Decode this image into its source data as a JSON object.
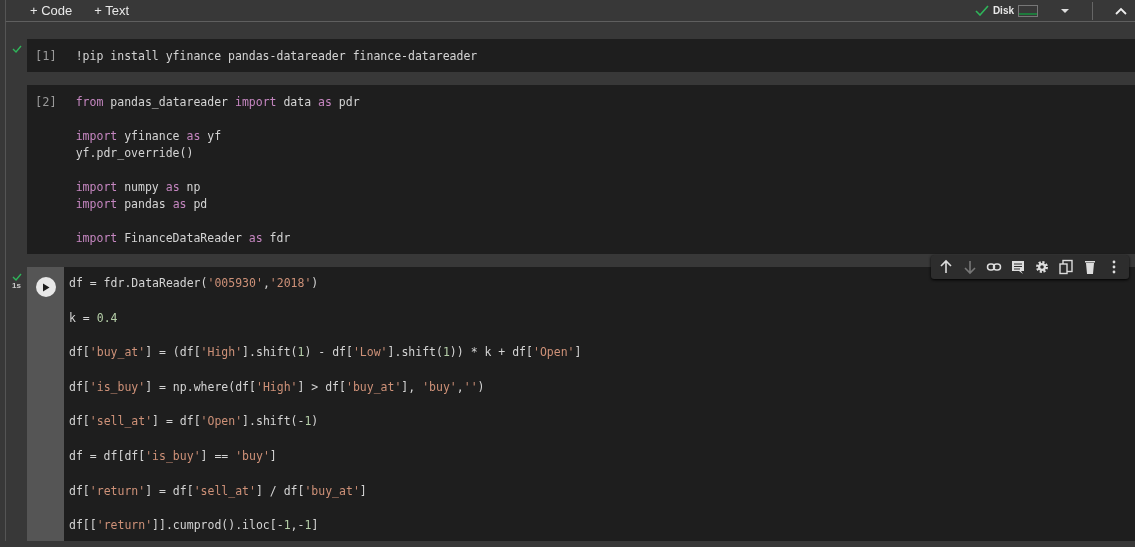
{
  "toolbar": {
    "add_buttons": [
      {
        "icon": "+",
        "label": "Code"
      },
      {
        "icon": "+",
        "label": "Text"
      }
    ],
    "resources": {
      "connected": true,
      "disk_label": "Disk"
    }
  },
  "cells": [
    {
      "execution": "[1]",
      "executed": true,
      "selected": false,
      "lines": [
        {
          "gap_before": false,
          "tokens": [
            {
              "kind": "plain",
              "text": "!pip install yfinance pandas-datareader finance-datareader"
            }
          ]
        }
      ]
    },
    {
      "execution": "[2]",
      "executed": false,
      "selected": false,
      "lines": [
        {
          "gap_before": false,
          "tokens": [
            {
              "kind": "kw",
              "text": "from"
            },
            {
              "kind": "plain",
              "text": " pandas_datareader "
            },
            {
              "kind": "kw",
              "text": "import"
            },
            {
              "kind": "plain",
              "text": " data "
            },
            {
              "kind": "kw",
              "text": "as"
            },
            {
              "kind": "plain",
              "text": " pdr"
            }
          ]
        },
        {
          "gap_before": true,
          "tokens": [
            {
              "kind": "kw",
              "text": "import"
            },
            {
              "kind": "plain",
              "text": " yfinance "
            },
            {
              "kind": "kw",
              "text": "as"
            },
            {
              "kind": "plain",
              "text": " yf"
            }
          ]
        },
        {
          "gap_before": false,
          "tokens": [
            {
              "kind": "plain",
              "text": "yf.pdr_override()"
            }
          ]
        },
        {
          "gap_before": true,
          "tokens": [
            {
              "kind": "kw",
              "text": "import"
            },
            {
              "kind": "plain",
              "text": " numpy "
            },
            {
              "kind": "kw",
              "text": "as"
            },
            {
              "kind": "plain",
              "text": " np"
            }
          ]
        },
        {
          "gap_before": false,
          "tokens": [
            {
              "kind": "kw",
              "text": "import"
            },
            {
              "kind": "plain",
              "text": " pandas "
            },
            {
              "kind": "kw",
              "text": "as"
            },
            {
              "kind": "plain",
              "text": " pd"
            }
          ]
        },
        {
          "gap_before": true,
          "tokens": [
            {
              "kind": "kw",
              "text": "import"
            },
            {
              "kind": "plain",
              "text": " FinanceDataReader "
            },
            {
              "kind": "kw",
              "text": "as"
            },
            {
              "kind": "plain",
              "text": " fdr"
            }
          ]
        }
      ]
    },
    {
      "executed": true,
      "duration": "1s",
      "selected": true,
      "lines": [
        {
          "gap_before": false,
          "tokens": [
            {
              "kind": "plain",
              "text": "df = fdr.DataReader("
            },
            {
              "kind": "str",
              "text": "'005930'"
            },
            {
              "kind": "plain",
              "text": ","
            },
            {
              "kind": "str",
              "text": "'2018'"
            },
            {
              "kind": "plain",
              "text": ")"
            }
          ]
        },
        {
          "gap_before": true,
          "tokens": [
            {
              "kind": "plain",
              "text": "k = "
            },
            {
              "kind": "num",
              "text": "0.4"
            }
          ]
        },
        {
          "gap_before": true,
          "tokens": [
            {
              "kind": "plain",
              "text": "df["
            },
            {
              "kind": "str",
              "text": "'buy_at'"
            },
            {
              "kind": "plain",
              "text": "] = (df["
            },
            {
              "kind": "str",
              "text": "'High'"
            },
            {
              "kind": "plain",
              "text": "].shift("
            },
            {
              "kind": "num",
              "text": "1"
            },
            {
              "kind": "plain",
              "text": ") - df["
            },
            {
              "kind": "str",
              "text": "'Low'"
            },
            {
              "kind": "plain",
              "text": "].shift("
            },
            {
              "kind": "num",
              "text": "1"
            },
            {
              "kind": "plain",
              "text": ")) * k + df["
            },
            {
              "kind": "str",
              "text": "'Open'"
            },
            {
              "kind": "plain",
              "text": "]"
            }
          ]
        },
        {
          "gap_before": true,
          "tokens": [
            {
              "kind": "plain",
              "text": "df["
            },
            {
              "kind": "str",
              "text": "'is_buy'"
            },
            {
              "kind": "plain",
              "text": "] = np.where(df["
            },
            {
              "kind": "str",
              "text": "'High'"
            },
            {
              "kind": "plain",
              "text": "] > df["
            },
            {
              "kind": "str",
              "text": "'buy_at'"
            },
            {
              "kind": "plain",
              "text": "], "
            },
            {
              "kind": "str",
              "text": "'buy'"
            },
            {
              "kind": "plain",
              "text": ","
            },
            {
              "kind": "str",
              "text": "''"
            },
            {
              "kind": "plain",
              "text": ")"
            }
          ]
        },
        {
          "gap_before": true,
          "tokens": [
            {
              "kind": "plain",
              "text": "df["
            },
            {
              "kind": "str",
              "text": "'sell_at'"
            },
            {
              "kind": "plain",
              "text": "] = df["
            },
            {
              "kind": "str",
              "text": "'Open'"
            },
            {
              "kind": "plain",
              "text": "].shift(-"
            },
            {
              "kind": "num",
              "text": "1"
            },
            {
              "kind": "plain",
              "text": ")"
            }
          ]
        },
        {
          "gap_before": true,
          "tokens": [
            {
              "kind": "plain",
              "text": "df = df[df["
            },
            {
              "kind": "str",
              "text": "'is_buy'"
            },
            {
              "kind": "plain",
              "text": "] == "
            },
            {
              "kind": "str",
              "text": "'buy'"
            },
            {
              "kind": "plain",
              "text": "]"
            }
          ]
        },
        {
          "gap_before": true,
          "tokens": [
            {
              "kind": "plain",
              "text": "df["
            },
            {
              "kind": "str",
              "text": "'return'"
            },
            {
              "kind": "plain",
              "text": "] = df["
            },
            {
              "kind": "str",
              "text": "'sell_at'"
            },
            {
              "kind": "plain",
              "text": "] / df["
            },
            {
              "kind": "str",
              "text": "'buy_at'"
            },
            {
              "kind": "plain",
              "text": "]"
            }
          ]
        },
        {
          "gap_before": true,
          "tokens": [
            {
              "kind": "plain",
              "text": "df[["
            },
            {
              "kind": "str",
              "text": "'return'"
            },
            {
              "kind": "plain",
              "text": "]].cumprod().iloc[-"
            },
            {
              "kind": "num",
              "text": "1"
            },
            {
              "kind": "plain",
              "text": ",-"
            },
            {
              "kind": "num",
              "text": "1"
            },
            {
              "kind": "plain",
              "text": "]"
            }
          ]
        }
      ]
    }
  ]
}
